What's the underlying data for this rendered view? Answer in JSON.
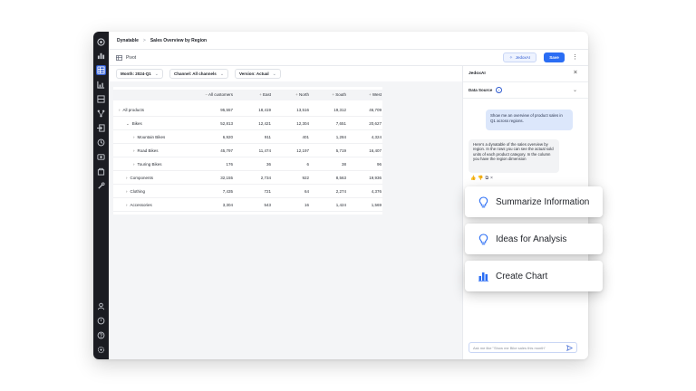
{
  "breadcrumb": {
    "app": "Dynatable",
    "separator": ">",
    "page": "Sales Overview by Region"
  },
  "toolbar": {
    "pivot_label": "Pivot",
    "jedox_ai_label": "JedoxAI",
    "save_label": "Save",
    "more_label": "⋮"
  },
  "filters": [
    {
      "label": "Month: 2024-Q1"
    },
    {
      "label": "Channel: All channels"
    },
    {
      "label": "Version: Actual"
    }
  ],
  "table": {
    "columns": [
      "All customers",
      "East",
      "North",
      "South",
      "West"
    ],
    "rows": [
      {
        "indent": 0,
        "caret": "›",
        "name": "All products",
        "values": [
          "95,557",
          "18,419",
          "13,516",
          "19,312",
          "46,709"
        ]
      },
      {
        "indent": 1,
        "caret": "⌄",
        "name": "Bikes",
        "values": [
          "52,813",
          "12,421",
          "12,304",
          "7,651",
          "20,627"
        ]
      },
      {
        "indent": 2,
        "caret": "›",
        "name": "Mountain Bikes",
        "values": [
          "6,920",
          "911",
          "401",
          "1,284",
          "4,324"
        ]
      },
      {
        "indent": 2,
        "caret": "›",
        "name": "Road Bikes",
        "values": [
          "45,797",
          "11,474",
          "12,197",
          "5,719",
          "16,407"
        ]
      },
      {
        "indent": 2,
        "caret": "›",
        "name": "Touring Bikes",
        "values": [
          "176",
          "36",
          "6",
          "38",
          "96"
        ]
      },
      {
        "indent": 1,
        "caret": "›",
        "name": "Components",
        "values": [
          "32,155",
          "2,734",
          "922",
          "8,563",
          "19,936"
        ]
      },
      {
        "indent": 1,
        "caret": "›",
        "name": "Clothing",
        "values": [
          "7,435",
          "721",
          "64",
          "2,274",
          "4,376"
        ]
      },
      {
        "indent": 1,
        "caret": "›",
        "name": "Accessories",
        "values": [
          "3,304",
          "543",
          "16",
          "1,424",
          "1,569"
        ]
      }
    ]
  },
  "panel": {
    "title": "JedoxAI",
    "data_source_label": "Data Source",
    "user_message": "Show me an overview of product sales in Q1 across regions.",
    "ai_message": "Here's a dynatable of the sales overview by region. In the rows you can see the actual sold units of each product category. In the column you have the region dimension",
    "ask_placeholder": "Ask me like \"Show me Bike sales this month\""
  },
  "cards": [
    {
      "label": "Summarize Information",
      "icon": "lightbulb-icon"
    },
    {
      "label": "Ideas for Analysis",
      "icon": "lightbulb-icon"
    },
    {
      "label": "Create Chart",
      "icon": "bar-chart-icon"
    }
  ],
  "colors": {
    "accent": "#2a6df4",
    "rail": "#1b1c22",
    "user_bubble": "#dce7fb"
  }
}
